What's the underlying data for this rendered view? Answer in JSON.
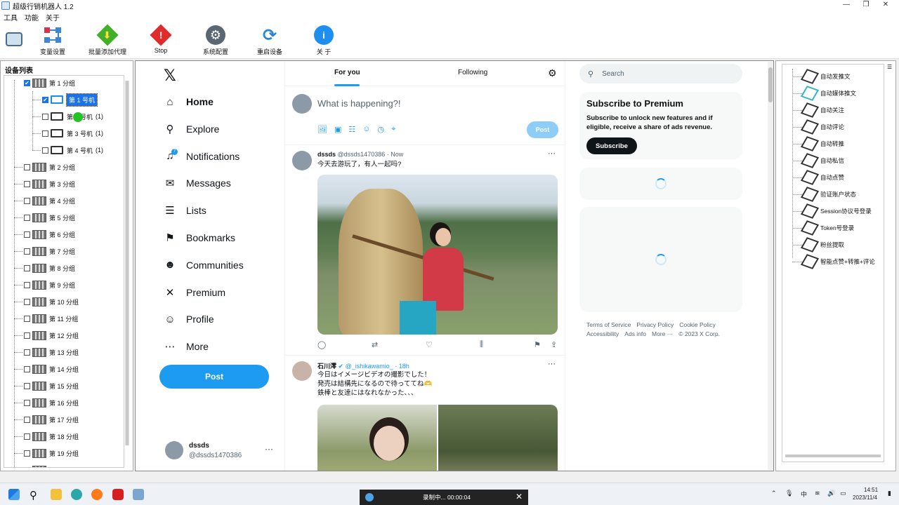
{
  "app": {
    "title": "超级行销机器人 1.2",
    "menu": [
      "工具",
      "功能",
      "关于"
    ],
    "toolbar": [
      {
        "label": "变量设置",
        "icon": "variable-icon",
        "color": "#4aa0e6"
      },
      {
        "label": "批量添加代理",
        "icon": "download-icon",
        "color": "#43b02a"
      },
      {
        "label": "Stop",
        "icon": "stop-icon",
        "color": "#e02b2b"
      },
      {
        "label": "系统配置",
        "icon": "gear-icon",
        "color": "#5a6672"
      },
      {
        "label": "重启设备",
        "icon": "restart-icon",
        "color": "#2a87d8"
      },
      {
        "label": "关 于",
        "icon": "info-icon",
        "color": "#1e8ef0"
      }
    ]
  },
  "devices": {
    "header": "设备列表",
    "group1": "第 1 分组",
    "phones": [
      {
        "label": "第 1 号机",
        "count": ""
      },
      {
        "label": "第 2 号机",
        "count": "(1)"
      },
      {
        "label": "第 3 号机",
        "count": "(1)"
      },
      {
        "label": "第 4 号机",
        "count": "(1)"
      }
    ],
    "groups": [
      "第 2 分组",
      "第 3 分组",
      "第 4 分组",
      "第 5 分组",
      "第 6 分组",
      "第 7 分组",
      "第 8 分组",
      "第 9 分组",
      "第 10 分组",
      "第 11 分组",
      "第 12 分组",
      "第 13 分组",
      "第 14 分组",
      "第 15 分组",
      "第 16 分组",
      "第 17 分组",
      "第 18 分组",
      "第 19 分组",
      "第 20 分组"
    ]
  },
  "x": {
    "logo": "𝕏",
    "nav": [
      {
        "label": "Home",
        "icon": "home-icon",
        "glyph": "⌂"
      },
      {
        "label": "Explore",
        "icon": "search-icon",
        "glyph": "⚲"
      },
      {
        "label": "Notifications",
        "icon": "bell-icon",
        "glyph": "♫"
      },
      {
        "label": "Messages",
        "icon": "mail-icon",
        "glyph": "✉"
      },
      {
        "label": "Lists",
        "icon": "list-icon",
        "glyph": "☰"
      },
      {
        "label": "Bookmarks",
        "icon": "bookmark-icon",
        "glyph": "⚑"
      },
      {
        "label": "Communities",
        "icon": "communities-icon",
        "glyph": "☻"
      },
      {
        "label": "Premium",
        "icon": "x-icon",
        "glyph": "✕"
      },
      {
        "label": "Profile",
        "icon": "profile-icon",
        "glyph": "☺"
      },
      {
        "label": "More",
        "icon": "more-icon",
        "glyph": "⋯"
      }
    ],
    "notif_badge": "7",
    "post_button": "Post",
    "account": {
      "name": "dssds",
      "handle": "@dssds1470386",
      "dots": "···"
    },
    "tabs": {
      "for_you": "For you",
      "following": "Following"
    },
    "compose": {
      "placeholder": "What is happening?!",
      "post": "Post",
      "tools": [
        "🖼",
        "▣",
        "☷",
        "☺",
        "◷",
        "⌖"
      ]
    },
    "tweets": [
      {
        "name": "dssds",
        "meta": "@dssds1470386 · Now",
        "text": "今天去游玩了，有人一起吗?"
      },
      {
        "name": "石川澪",
        "meta": "✔ @_ishikawamio_ · 18h",
        "text": "今日はイメージビデオの撮影でした！\n発売は結構先になるので待っててね🫶\n鉄棒と友達にはなれなかった、、、"
      }
    ],
    "actions": [
      "◯",
      "⇄",
      "♡",
      "⫼",
      "⚑",
      "⇪"
    ],
    "search": "Search",
    "premium": {
      "title": "Subscribe to Premium",
      "body": "Subscribe to unlock new features and if eligible, receive a share of ads revenue.",
      "button": "Subscribe"
    },
    "footer": [
      "Terms of Service",
      "Privacy Policy",
      "Cookie Policy",
      "Accessibility",
      "Ads info",
      "More ···",
      "© 2023 X Corp."
    ]
  },
  "functions": [
    "自动发推文",
    "自动媒体推文",
    "自动关注",
    "自动评论",
    "自动转推",
    "自动私信",
    "自动点赞",
    "验证账户状态",
    "Session协议号登录",
    "Token号登录",
    "粉丝提取",
    "智能点赞+转推+评论"
  ],
  "recorder": {
    "text": "录制中... 00:00:04",
    "close": "✕"
  },
  "tray": {
    "time": "14:51",
    "date": "2023/11/4",
    "ime": "中"
  }
}
